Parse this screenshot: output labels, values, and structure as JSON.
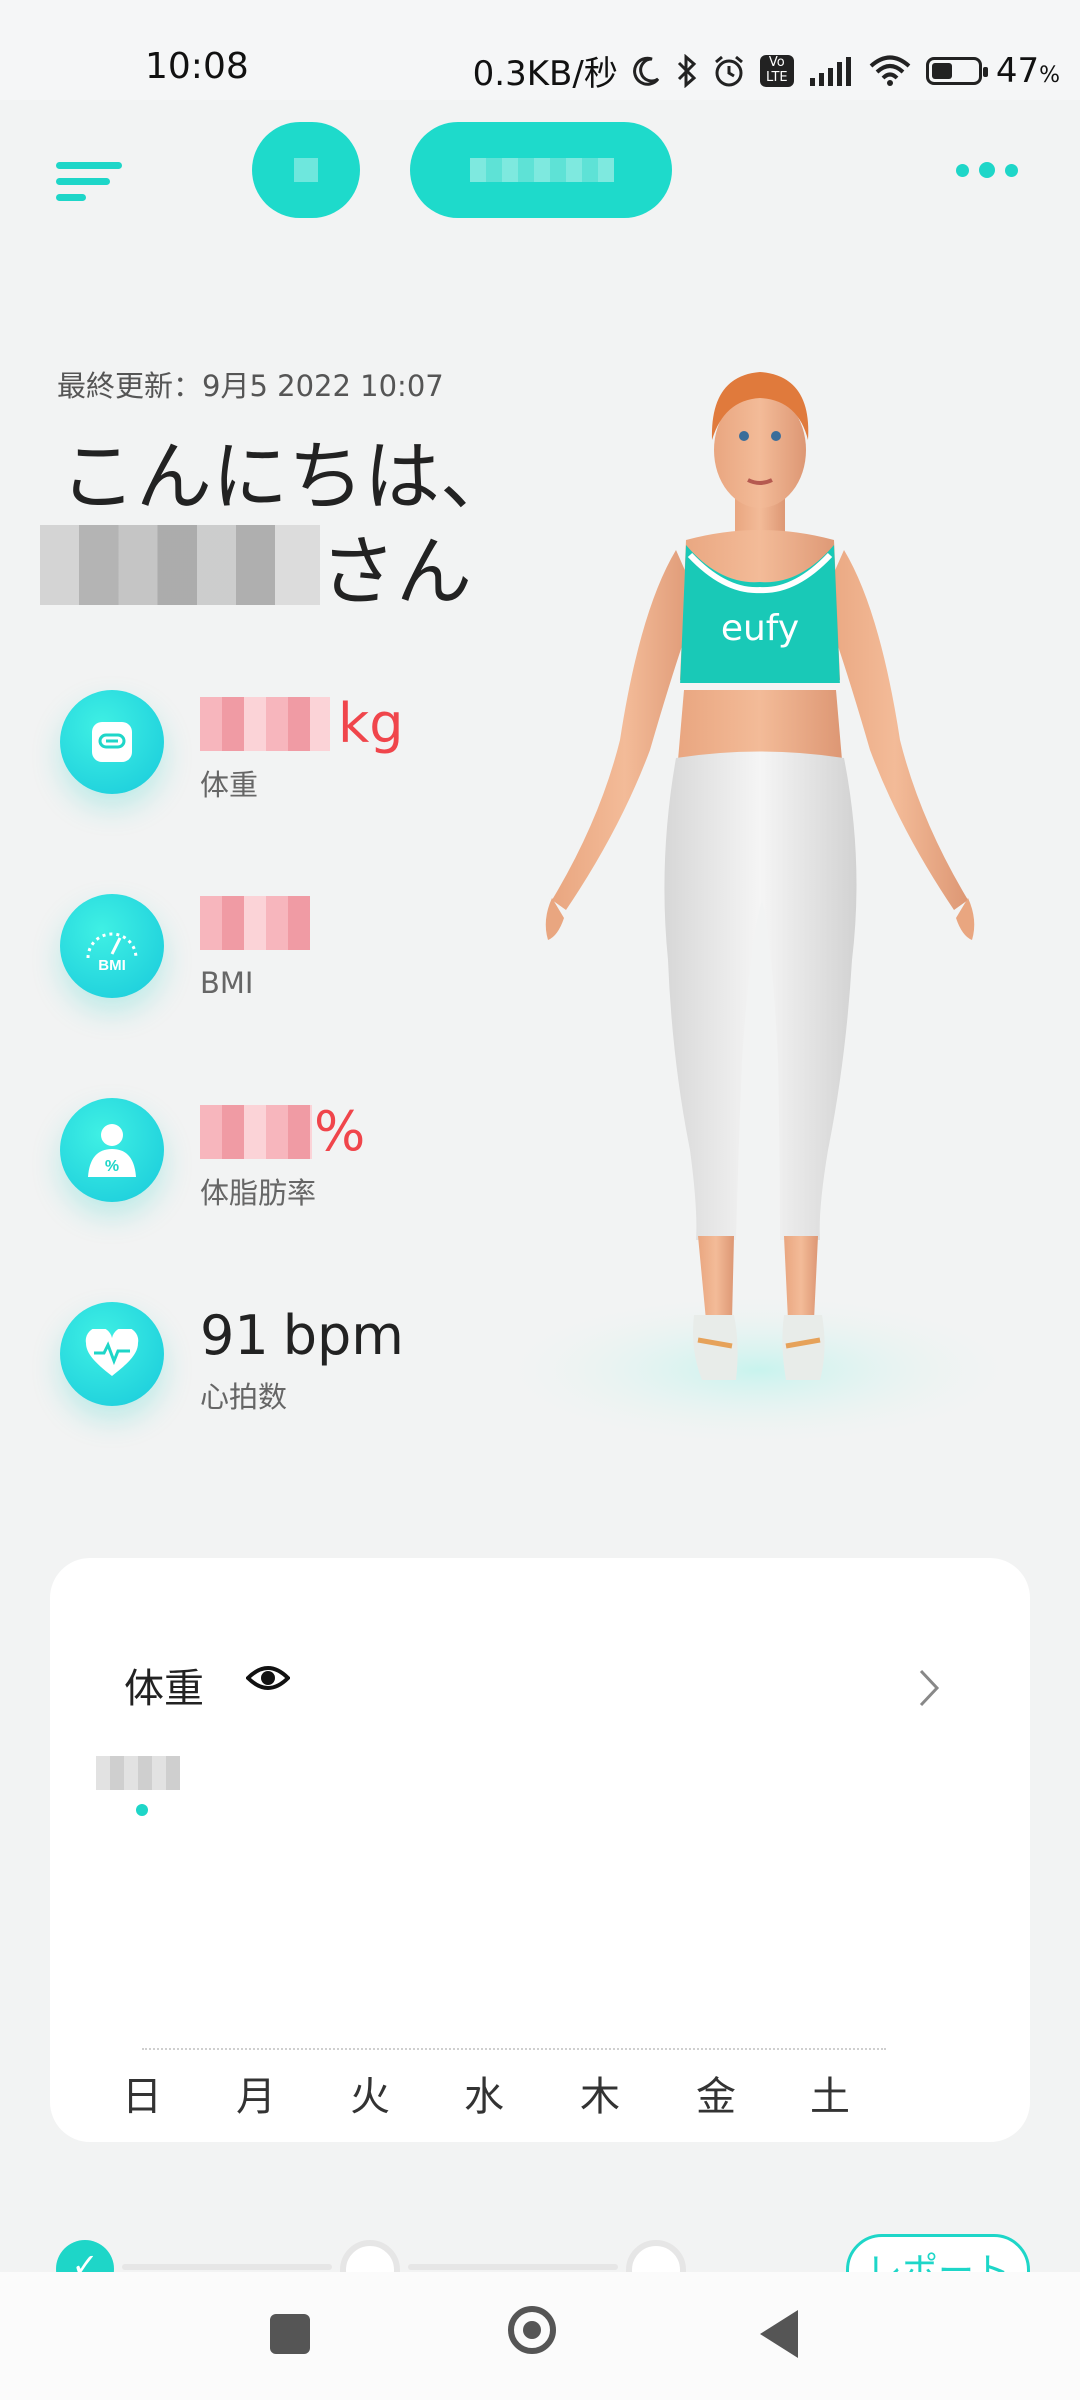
{
  "status_bar": {
    "time": "10:08",
    "network_speed": "0.3KB/秒",
    "volte_label": "Vo LTE",
    "battery_percent": "47",
    "battery_unit": "%",
    "icons": [
      "moon-icon",
      "bluetooth-icon",
      "alarm-icon",
      "volte-icon",
      "signal-icon",
      "wifi-icon",
      "battery-icon"
    ]
  },
  "header": {
    "icons": [
      "menu-icon",
      "more-icon"
    ],
    "accent": "#1ed6c8"
  },
  "profile": {
    "last_updated": "最終更新：9月5 2022 10:07",
    "greeting": "こんにちは、",
    "name_suffix": "さん"
  },
  "metrics": [
    {
      "icon": "scale-icon",
      "unit": "kg",
      "label": "体重"
    },
    {
      "icon": "bmi-gauge-icon",
      "icon_text": "BMI",
      "unit": "",
      "label": "BMI"
    },
    {
      "icon": "body-fat-icon",
      "icon_text": "%",
      "unit": "%",
      "label": "体脂肪率"
    },
    {
      "icon": "heart-rate-icon",
      "value": "91",
      "unit": "bpm",
      "label": "心拍数"
    }
  ],
  "avatar": {
    "top_logo": "eufy"
  },
  "weight_card": {
    "title": "体重",
    "days": [
      "日",
      "月",
      "火",
      "水",
      "木",
      "金",
      "土"
    ]
  },
  "progress": {
    "report_label": "レポート"
  },
  "colors": {
    "accent": "#1ed6c8",
    "alert_red": "#f0454b",
    "background": "#f2f3f3"
  }
}
